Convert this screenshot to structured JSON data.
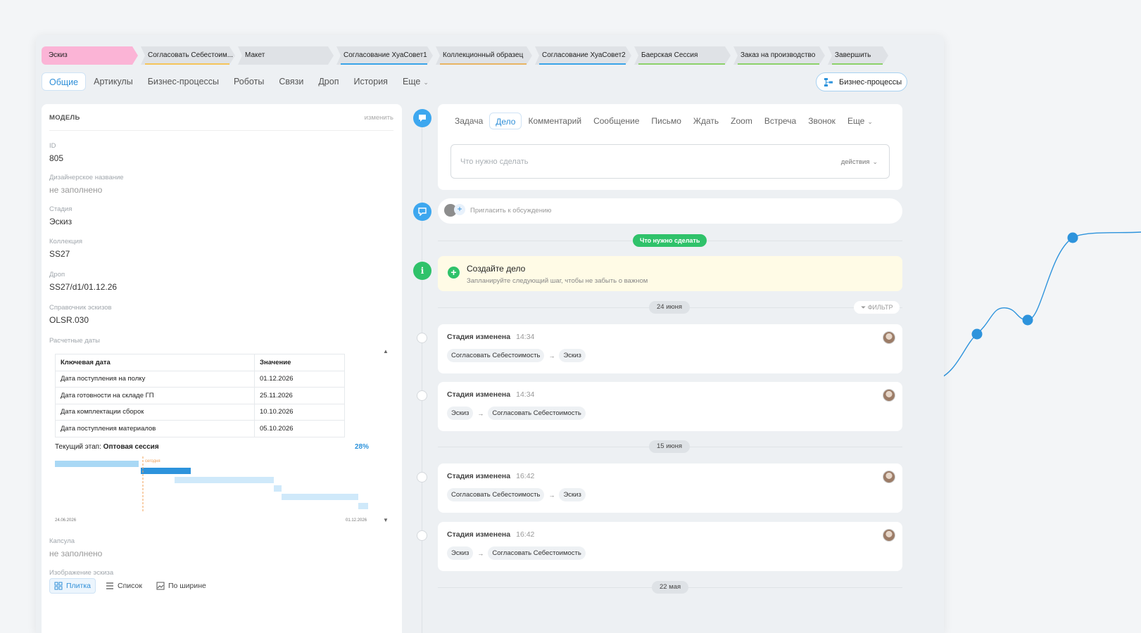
{
  "colors": {
    "accent": "#2f8fd8",
    "stage_active": "#fbb4d6",
    "green": "#2fc26a",
    "stage_gray": "#dfe2e6",
    "todo_bg": "#fffbe6"
  },
  "stages": [
    {
      "label": "Эскиз",
      "color": "#fbb4d6",
      "underline": ""
    },
    {
      "label": "Согласовать Себестоим...",
      "color": "#dfe2e6",
      "underline": "#f5c45a"
    },
    {
      "label": "Макет",
      "color": "#dfe2e6",
      "underline": ""
    },
    {
      "label": "Согласование ХуаСовет1",
      "color": "#dfe2e6",
      "underline": "#3aa4e8"
    },
    {
      "label": "Коллекционный образец",
      "color": "#dfe2e6",
      "underline": "#e8b463"
    },
    {
      "label": "Согласование ХуаСовет2",
      "color": "#dfe2e6",
      "underline": "#3aa4e8"
    },
    {
      "label": "Баерская Сессия",
      "color": "#dfe2e6",
      "underline": "#8cd16a"
    },
    {
      "label": "Заказ на производство",
      "color": "#dfe2e6",
      "underline": "#8cd16a"
    },
    {
      "label": "Завершить",
      "color": "#dfe2e6",
      "underline": "#8cd16a"
    }
  ],
  "tabs": [
    "Общие",
    "Артикулы",
    "Бизнес-процессы",
    "Роботы",
    "Связи",
    "Дроп",
    "История",
    "Еще"
  ],
  "bp_button": "Бизнес-процессы",
  "model": {
    "title": "МОДЕЛЬ",
    "edit": "изменить",
    "fields": {
      "id": {
        "label": "ID",
        "value": "805"
      },
      "design_name": {
        "label": "Дизайнерское название",
        "value": "не заполнено"
      },
      "stage": {
        "label": "Стадия",
        "value": "Эскиз"
      },
      "collection": {
        "label": "Коллекция",
        "value": "SS27"
      },
      "drop": {
        "label": "Дроп",
        "value": "SS27/d1/01.12.26"
      },
      "sketch_ref": {
        "label": "Справочник эскизов",
        "value": "OLSR.030"
      },
      "calc_dates": {
        "label": "Расчетные даты"
      },
      "capsule": {
        "label": "Капсула",
        "value": "не заполнено"
      },
      "sketch_image": {
        "label": "Изображение эскиза"
      }
    },
    "key_dates": {
      "headers": [
        "Ключевая дата",
        "Значение"
      ],
      "rows": [
        [
          "Дата поступления на полку",
          "01.12.2026"
        ],
        [
          "Дата готовности на складе ГП",
          "25.11.2026"
        ],
        [
          "Дата комплектации сборок",
          "10.10.2026"
        ],
        [
          "Дата поступления материалов",
          "05.10.2026"
        ]
      ]
    },
    "current_stage_label": "Текущий этап:",
    "current_stage": "Оптовая сессия",
    "progress": "28%",
    "gantt": {
      "today_label": "сегодня",
      "start_date": "24.06.2026",
      "end_date": "01.12.2026"
    },
    "view_options": [
      "Плитка",
      "Список",
      "По ширине"
    ]
  },
  "composer": {
    "tabs": [
      "Задача",
      "Дело",
      "Комментарий",
      "Сообщение",
      "Письмо",
      "Ждать",
      "Zoom",
      "Встреча",
      "Звонок",
      "Еще"
    ],
    "placeholder": "Что нужно сделать",
    "actions": "действия"
  },
  "invite": "Пригласить к обсуждению",
  "todo_pill": "Что нужно сделать",
  "todo": {
    "title": "Создайте дело",
    "subtitle": "Запланируйте следующий шаг, чтобы не забыть о важном"
  },
  "filter": "ФИЛЬТР",
  "dates": [
    "24 июня",
    "15 июня",
    "22 мая"
  ],
  "events": [
    {
      "title": "Стадия изменена",
      "time": "14:34",
      "from": "Согласовать Себестоимость",
      "to": "Эскиз"
    },
    {
      "title": "Стадия изменена",
      "time": "14:34",
      "from": "Эскиз",
      "to": "Согласовать Себестоимость"
    },
    {
      "title": "Стадия изменена",
      "time": "16:42",
      "from": "Согласовать Себестоимость",
      "to": "Эскиз"
    },
    {
      "title": "Стадия изменена",
      "time": "16:42",
      "from": "Эскиз",
      "to": "Согласовать Себестоимость"
    }
  ],
  "arrow": "→",
  "icons": {
    "chevron": "chevron-down-icon",
    "bp": "business-process-icon",
    "info": "info-icon",
    "chat": "chat-icon",
    "filter": "filter-icon"
  }
}
